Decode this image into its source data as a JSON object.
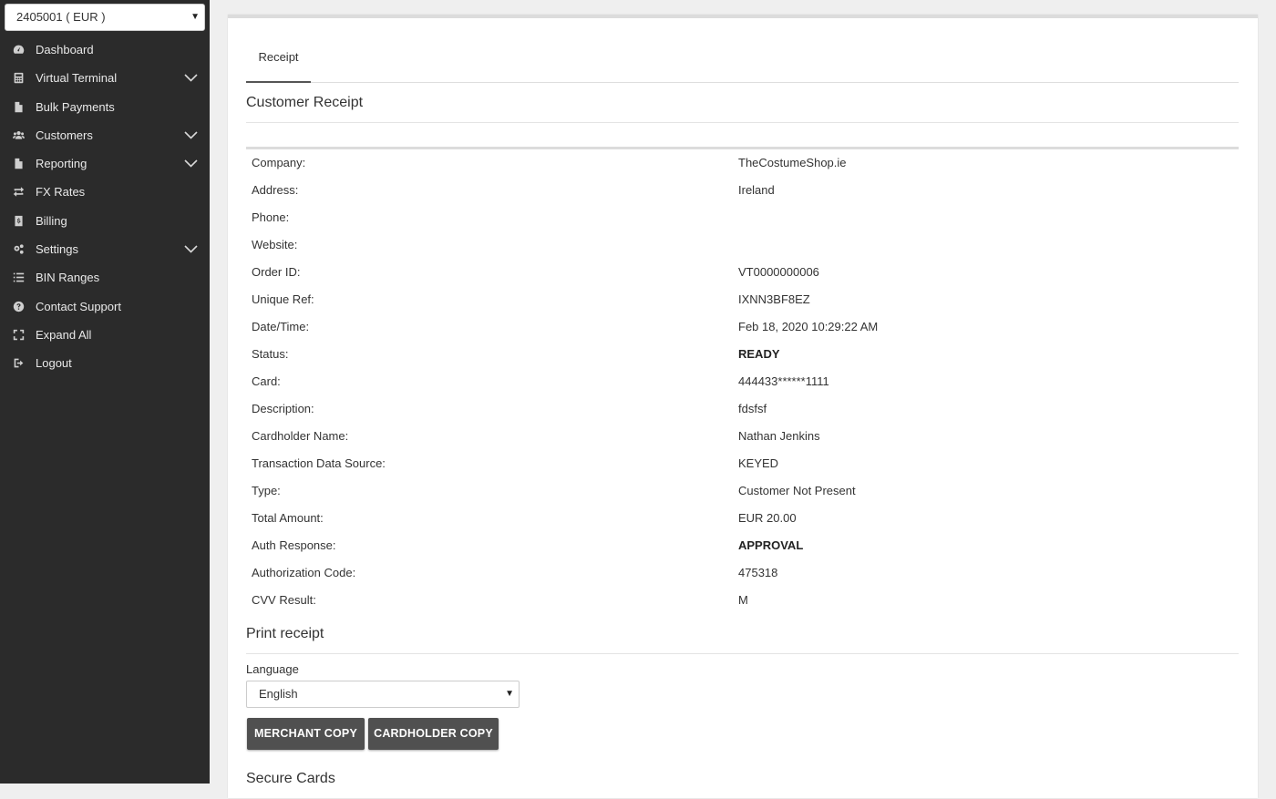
{
  "sidebar": {
    "account_select": "2405001 ( EUR )",
    "items": [
      {
        "label": "Dashboard",
        "icon": "dashboard-icon"
      },
      {
        "label": "Virtual Terminal",
        "icon": "calculator-icon"
      },
      {
        "label": "Bulk Payments",
        "icon": "document-icon"
      },
      {
        "label": "Customers",
        "icon": "users-icon"
      },
      {
        "label": "Reporting",
        "icon": "document-icon"
      },
      {
        "label": "FX Rates",
        "icon": "exchange-icon"
      },
      {
        "label": "Billing",
        "icon": "dollar-file-icon"
      },
      {
        "label": "Settings",
        "icon": "gears-icon"
      },
      {
        "label": "BIN Ranges",
        "icon": "list-icon"
      },
      {
        "label": "Contact Support",
        "icon": "question-icon"
      },
      {
        "label": "Expand All",
        "icon": "expand-icon"
      },
      {
        "label": "Logout",
        "icon": "logout-icon"
      }
    ]
  },
  "main": {
    "tab_label": "Receipt",
    "customer_receipt_title": "Customer Receipt",
    "receipt": {
      "company": {
        "label": "Company:",
        "value": "TheCostumeShop.ie"
      },
      "address": {
        "label": "Address:",
        "value": "Ireland"
      },
      "phone": {
        "label": "Phone:",
        "value": ""
      },
      "website": {
        "label": "Website:",
        "value": ""
      },
      "order_id": {
        "label": "Order ID:",
        "value": "VT0000000006"
      },
      "unique_ref": {
        "label": "Unique Ref:",
        "value": "IXNN3BF8EZ"
      },
      "datetime": {
        "label": "Date/Time:",
        "value": "Feb 18, 2020 10:29:22 AM"
      },
      "status": {
        "label": "Status:",
        "value": "READY"
      },
      "card": {
        "label": "Card:",
        "value": "444433******1111"
      },
      "description": {
        "label": "Description:",
        "value": "fdsfsf"
      },
      "cardholder": {
        "label": "Cardholder Name:",
        "value": "Nathan Jenkins"
      },
      "data_source": {
        "label": "Transaction Data Source:",
        "value": "KEYED"
      },
      "type": {
        "label": "Type:",
        "value": "Customer Not Present"
      },
      "total": {
        "label": "Total Amount:",
        "value": "EUR 20.00"
      },
      "auth_response": {
        "label": "Auth Response:",
        "value": "APPROVAL"
      },
      "auth_code": {
        "label": "Authorization Code:",
        "value": "475318"
      },
      "cvv": {
        "label": "CVV Result:",
        "value": "M"
      }
    },
    "print_title": "Print receipt",
    "language_label": "Language",
    "language_value": "English",
    "merchant_copy": "MERCHANT COPY",
    "cardholder_copy": "CARDHOLDER COPY",
    "secure_cards_title": "Secure Cards"
  }
}
